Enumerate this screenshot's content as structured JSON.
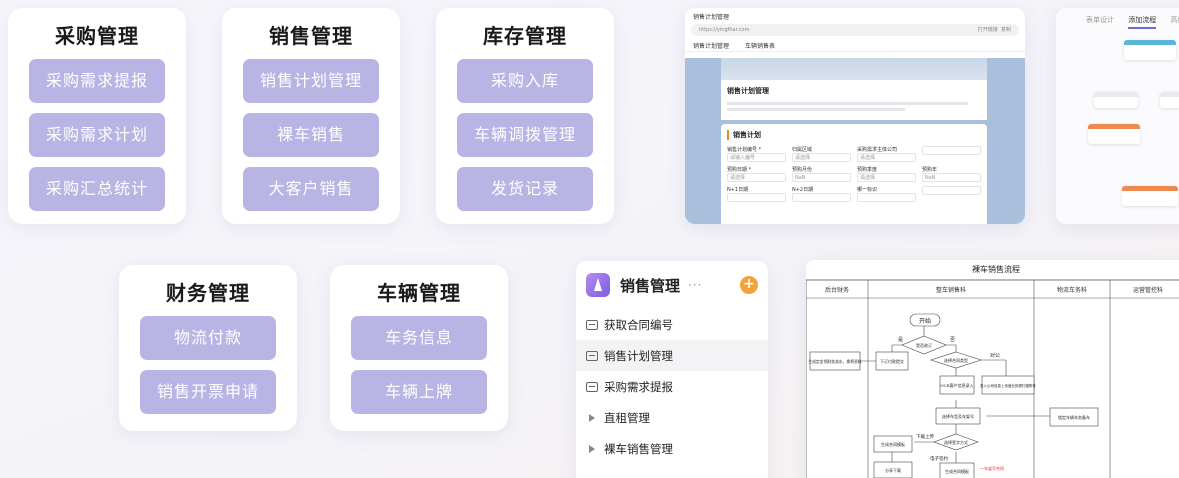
{
  "modules": [
    {
      "title": "采购管理",
      "items": [
        "采购需求提报",
        "采购需求计划",
        "采购汇总统计"
      ]
    },
    {
      "title": "销售管理",
      "items": [
        "销售计划管理",
        "裸车销售",
        "大客户销售"
      ]
    },
    {
      "title": "库存管理",
      "items": [
        "采购入库",
        "车辆调拨管理",
        "发货记录"
      ]
    },
    {
      "title": "财务管理",
      "items": [
        "物流付款",
        "销售开票申请"
      ]
    },
    {
      "title": "车辆管理",
      "items": [
        "车务信息",
        "车辆上牌"
      ]
    }
  ],
  "colors": {
    "pill": "#b8b4e3",
    "accent_orange": "#f3a23a",
    "form_bg": "#a9bfdc"
  },
  "form_screenshot": {
    "window_title": "销售计划管理",
    "url": "https://yingfhar.com",
    "url_right_1": "打开链接",
    "url_right_2": "复制",
    "tabs": [
      "销售计划管理",
      "车辆销售表"
    ],
    "panel_title": "销售计划管理",
    "section_title": "销售计划",
    "fields": [
      {
        "label": "销售计划编号 *",
        "value": "请输入编号"
      },
      {
        "label": "归属区域",
        "value": "请选择"
      },
      {
        "label": "采购需求主体公司",
        "value": "请选择"
      },
      {
        "label": "",
        "value": ""
      },
      {
        "label": "预购日期 *",
        "value": "请选择"
      },
      {
        "label": "预购月份",
        "value": "NaN"
      },
      {
        "label": "预购季度",
        "value": "请选择"
      },
      {
        "label": "预购年",
        "value": "NaN"
      },
      {
        "label": "N+1日期",
        "value": ""
      },
      {
        "label": "N+2日期",
        "value": ""
      },
      {
        "label": "哪一标识",
        "value": ""
      },
      {
        "label": "",
        "value": ""
      }
    ]
  },
  "flow_screenshot": {
    "tabs": [
      "表单设计",
      "添加流程",
      "高级设置"
    ],
    "active_tab": 1
  },
  "sidebar": {
    "title": "销售管理",
    "more": "···",
    "add": "+",
    "items": [
      {
        "label": "获取合同编号",
        "type": "page",
        "active": false
      },
      {
        "label": "销售计划管理",
        "type": "page",
        "active": true
      },
      {
        "label": "采购需求提报",
        "type": "page",
        "active": false
      },
      {
        "label": "直租管理",
        "type": "group",
        "active": false
      },
      {
        "label": "裸车销售管理",
        "type": "group",
        "active": false
      }
    ]
  },
  "flowchart": {
    "title": "裸车销售流程",
    "lanes": [
      "后台财务",
      "整车销售科",
      "物流车务科",
      "运营管控科"
    ],
    "nodes": {
      "start": "开始",
      "d1": "是否收订",
      "yes": "是",
      "no": "否",
      "finance": "生成定金领财务流水，换将资料",
      "order": "下订付款提交",
      "d2": "选择合同类型",
      "ocr": "OCR客户信息录入",
      "upload": "录入公司信息上传营业执照扫描附件",
      "right_label": "对公",
      "select_car": "选择车型及车架号",
      "lock_car": "锁定车辆车务备车",
      "d3": "选择签字方式",
      "download": "下载上传",
      "gen_contract": "生成合同模板",
      "esign": "电子签约",
      "gen_contract2": "生成合同模板",
      "share": "分享下载",
      "red_note": "一车架号合同"
    }
  }
}
